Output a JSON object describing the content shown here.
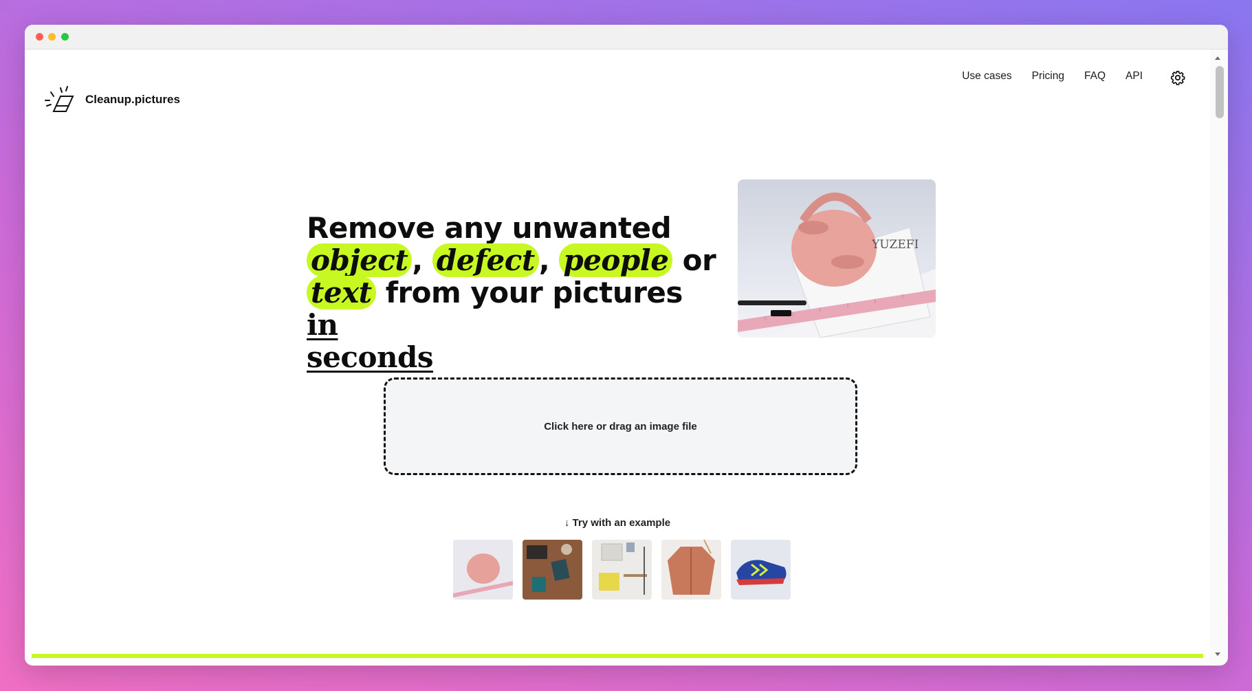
{
  "brand": {
    "name": "Cleanup.pictures",
    "logo_icon": "eraser-icon"
  },
  "nav": {
    "items": [
      "Use cases",
      "Pricing",
      "FAQ",
      "API"
    ],
    "settings_icon": "gear-icon"
  },
  "hero": {
    "line1": "Remove any unwanted",
    "word_object": "object",
    "comma1": ",",
    "word_defect": "defect",
    "comma2": ",",
    "word_people": "people",
    "word_or": "or",
    "word_text": "text",
    "middle": "from your pictures",
    "word_in": "in",
    "word_seconds": "seconds"
  },
  "dropzone": {
    "label": "Click here or drag an image file"
  },
  "examples": {
    "title": "↓ Try with an example",
    "items": [
      "handbag",
      "desk",
      "room",
      "jacket",
      "sneaker"
    ]
  },
  "colors": {
    "accent": "#c8f821",
    "text": "#0d0d0d"
  }
}
